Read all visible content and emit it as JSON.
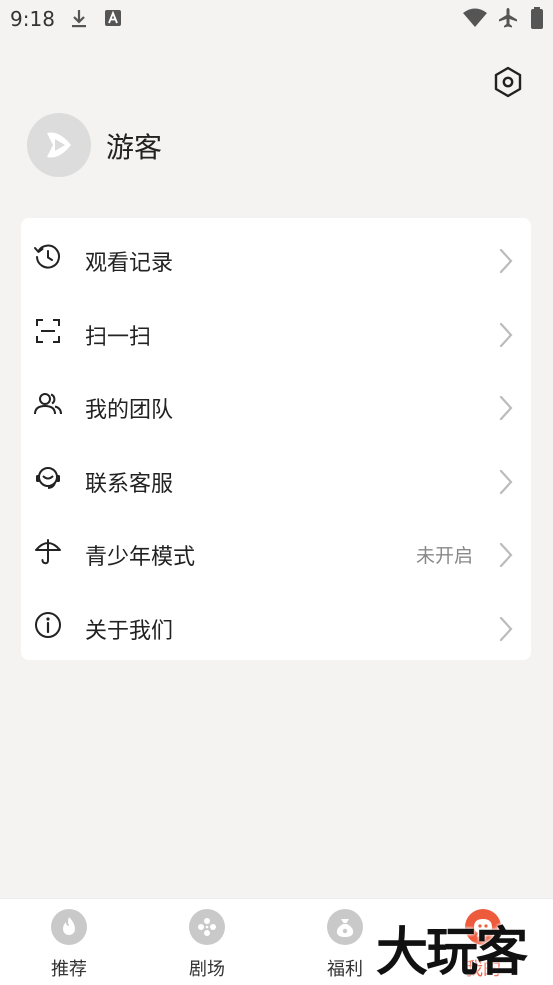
{
  "status_bar": {
    "time": "9:18",
    "icons": [
      "download-icon",
      "app-notification-icon",
      "wifi-icon",
      "airplane-icon",
      "battery-icon"
    ]
  },
  "header": {
    "settings_icon": "settings-icon"
  },
  "profile": {
    "username": "游客",
    "avatar_icon": "play-logo-icon"
  },
  "menu": {
    "items": [
      {
        "icon": "history-icon",
        "label": "观看记录"
      },
      {
        "icon": "scan-icon",
        "label": "扫一扫"
      },
      {
        "icon": "team-icon",
        "label": "我的团队"
      },
      {
        "icon": "customer-service-icon",
        "label": "联系客服"
      },
      {
        "icon": "umbrella-icon",
        "label": "青少年模式",
        "value": "未开启"
      },
      {
        "icon": "info-icon",
        "label": "关于我们"
      }
    ]
  },
  "bottom_nav": {
    "items": [
      {
        "icon": "fire-icon",
        "label": "推荐"
      },
      {
        "icon": "film-reel-icon",
        "label": "剧场"
      },
      {
        "icon": "gift-bag-icon",
        "label": "福利"
      },
      {
        "icon": "profile-icon",
        "label": "我的",
        "active": true
      }
    ],
    "active_color": "#ee5a3c"
  },
  "watermark": {
    "text": "大玩客"
  }
}
